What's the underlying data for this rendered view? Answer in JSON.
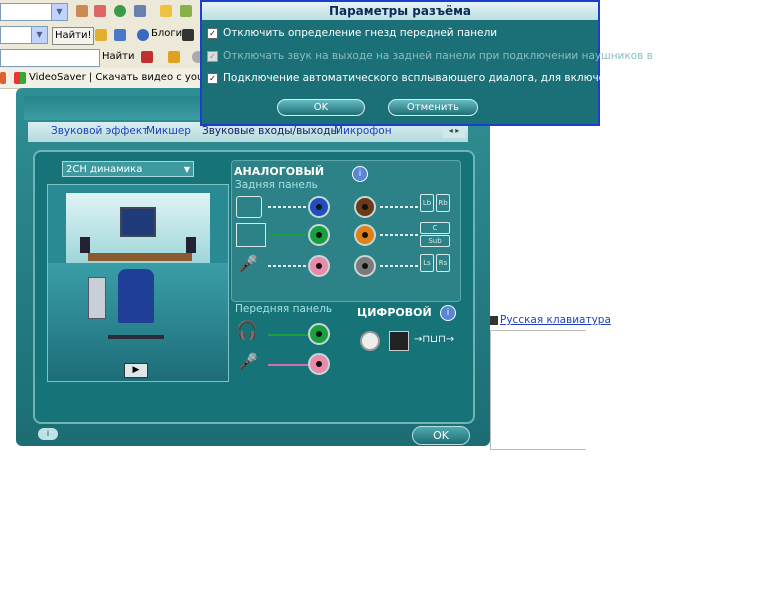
{
  "browser": {
    "find_label": "Найти!",
    "search_label": "Найти",
    "blogs_label": "Блоги",
    "tab_title": "VideoSaver | Скачать видео с youtub..."
  },
  "manager": {
    "tabs": [
      "Звуковой эффект",
      "Микшер",
      "Звуковые входы/выходы",
      "Микрофон"
    ],
    "speaker_config": "2CH динамика",
    "analog_title": "АНАЛОГОВЫЙ",
    "rear_panel": "Задняя панель",
    "front_panel": "Передняя панель",
    "digital_title": "ЦИФРОВОЙ",
    "speaker_labels": [
      "Lb",
      "Rb",
      "C",
      "Sub",
      "Ls",
      "Rs"
    ],
    "ok_label": "OK",
    "info_icon": "info-icon"
  },
  "dialog": {
    "title": "Параметры разъёма",
    "options": [
      {
        "label": "Отключить определение гнезд передней панели",
        "checked": true,
        "disabled": false
      },
      {
        "label": "Отключать звук на выходе на задней панели при подключении наушников в",
        "checked": true,
        "disabled": true
      },
      {
        "label": "Подключение автоматического всплывающего диалога, для включенного уст",
        "checked": true,
        "disabled": false
      }
    ],
    "ok_label": "OK",
    "cancel_label": "Отменить"
  },
  "page": {
    "keyboard_link": "Русская клавиатура"
  },
  "colors": {
    "jack_blue": "#1f4fbf",
    "jack_green": "#18a040",
    "jack_pink": "#e88aa8",
    "jack_brown": "#6b3a18",
    "jack_orange": "#e08018",
    "jack_gray": "#7a7a7a",
    "dialog_border": "#1c3ed0"
  }
}
